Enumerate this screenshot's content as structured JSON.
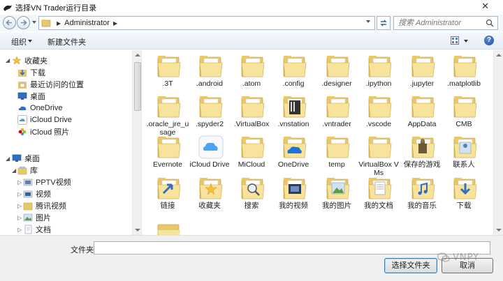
{
  "window": {
    "title": "选择VN Trader运行目录",
    "close_glyph": "✕"
  },
  "address": {
    "crumb_sep": "▶",
    "path": "Administrator",
    "trailing_sep": "▶"
  },
  "search": {
    "placeholder": "搜索 Administrator"
  },
  "toolbar": {
    "organize_label": "组织",
    "new_folder_label": "新建文件夹",
    "help_glyph": "?"
  },
  "nav": {
    "favorites_label": "收藏夹",
    "favorites": [
      "下载",
      "最近访问的位置",
      "桌面",
      "OneDrive",
      "iCloud Drive",
      "iCloud 照片"
    ],
    "desktop_label": "桌面",
    "library_label": "库",
    "libraries": [
      "PPTV视频",
      "视频",
      "腾讯视频",
      "图片",
      "文档"
    ]
  },
  "files": [
    {
      "name": ".3T",
      "icon": "folder-icon"
    },
    {
      "name": ".android",
      "icon": "folder-icon"
    },
    {
      "name": ".atom",
      "icon": "folder-icon"
    },
    {
      "name": ".config",
      "icon": "folder-icon"
    },
    {
      "name": ".designer",
      "icon": "folder-icon"
    },
    {
      "name": ".ipython",
      "icon": "folder-icon"
    },
    {
      "name": ".jupyter",
      "icon": "folder-icon"
    },
    {
      "name": ".matplotlib",
      "icon": "folder-icon"
    },
    {
      "name": ".oracle_jre_usage",
      "icon": "folder-icon"
    },
    {
      "name": ".spyder2",
      "icon": "folder-icon"
    },
    {
      "name": ".VirtualBox",
      "icon": "folder-icon"
    },
    {
      "name": ".vnstation",
      "icon": "vnstation-folder-icon"
    },
    {
      "name": ".vntrader",
      "icon": "folder-icon"
    },
    {
      "name": ".vscode",
      "icon": "folder-icon"
    },
    {
      "name": "AppData",
      "icon": "folder-icon"
    },
    {
      "name": "CMB",
      "icon": "folder-icon"
    },
    {
      "name": "Evernote",
      "icon": "folder-icon"
    },
    {
      "name": "iCloud Drive",
      "icon": "icloud-drive-icon"
    },
    {
      "name": "MiCloud",
      "icon": "folder-icon"
    },
    {
      "name": "OneDrive",
      "icon": "onedrive-folder-icon"
    },
    {
      "name": "temp",
      "icon": "folder-icon"
    },
    {
      "name": "VirtualBox VMs",
      "icon": "folder-icon"
    },
    {
      "name": "保存的游戏",
      "icon": "saved-games-icon"
    },
    {
      "name": "联系人",
      "icon": "contacts-icon"
    },
    {
      "name": "链接",
      "icon": "links-icon"
    },
    {
      "name": "收藏夹",
      "icon": "favorites-folder-icon"
    },
    {
      "name": "搜索",
      "icon": "searches-folder-icon"
    },
    {
      "name": "我的视频",
      "icon": "my-videos-icon"
    },
    {
      "name": "我的图片",
      "icon": "my-pictures-icon"
    },
    {
      "name": "我的文档",
      "icon": "my-documents-icon"
    },
    {
      "name": "我的音乐",
      "icon": "my-music-icon"
    },
    {
      "name": "下载",
      "icon": "downloads-folder-icon"
    }
  ],
  "bottom": {
    "folder_label": "文件夹:",
    "folder_value": "",
    "select_button": "选择文件夹",
    "cancel_button": "取消"
  },
  "watermark": "VNPY",
  "colors": {
    "folder_back": "#e8c86a",
    "folder_front": "#f7e39b",
    "accent": "#3c7fb1"
  }
}
